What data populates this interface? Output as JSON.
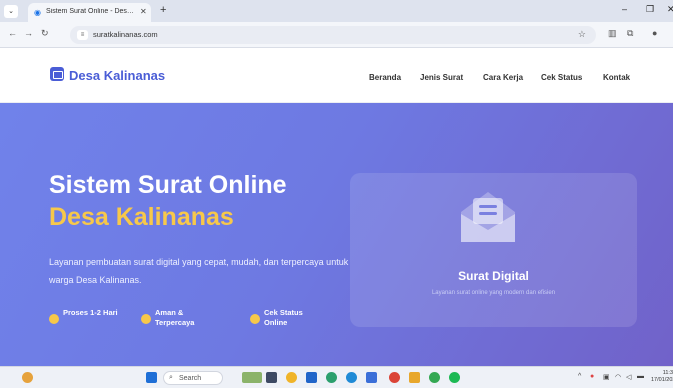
{
  "browser": {
    "tab_title": "Sistem Surat Online - Desa Kali",
    "tab_close": "✕",
    "new_tab": "+",
    "url": "suratkalinanas.com"
  },
  "site": {
    "brand": "Desa Kalinanas",
    "nav": [
      "Beranda",
      "Jenis Surat",
      "Cara Kerja",
      "Cek Status",
      "Kontak"
    ]
  },
  "hero": {
    "title_line1": "Sistem Surat Online",
    "title_line2": "Desa Kalinanas",
    "description": "Layanan pembuatan surat digital yang cepat, mudah, dan terpercaya untuk warga Desa Kalinanas.",
    "features": [
      {
        "label": "Proses 1-2 Hari",
        "icon": "clock-icon"
      },
      {
        "label": "Aman & Terpercaya",
        "icon": "shield-icon"
      },
      {
        "label": "Cek Status Online",
        "icon": "search-icon"
      }
    ],
    "card": {
      "title": "Surat Digital",
      "subtitle": "Layanan surat online yang modern dan efisien"
    }
  },
  "taskbar": {
    "search_placeholder": "Search",
    "clock_time": "11:3",
    "clock_date": "17/01/202"
  },
  "colors": {
    "brand": "#4a5dd6",
    "hero_gradient_start": "#7082ea",
    "hero_gradient_end": "#7162c9",
    "accent_yellow": "#f7c84a"
  }
}
